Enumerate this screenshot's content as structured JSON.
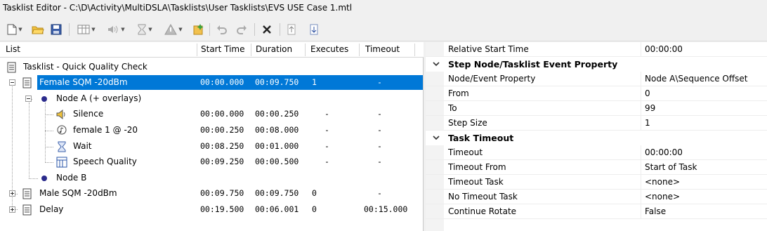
{
  "window": {
    "title": "Tasklist Editor - C:\\D\\Activity\\MultiDSLA\\Tasklists\\User Tasklists\\EVS USE Case 1.mtl"
  },
  "toolbar": {
    "buttons": [
      "new-icon",
      "open-folder-icon",
      "save-icon",
      "table-icon",
      "volume-icon",
      "hourglass-icon",
      "warning-icon",
      "add-task-icon",
      "undo-icon",
      "redo-icon",
      "delete-icon",
      "move-up-icon",
      "move-down-icon"
    ]
  },
  "list": {
    "headers": {
      "list": "List",
      "start": "Start Time",
      "duration": "Duration",
      "executes": "Executes",
      "timeout": "Timeout"
    },
    "rows": [
      {
        "label": "Tasklist - Quick Quality Check",
        "start": "",
        "duration": "",
        "executes": "",
        "timeout": ""
      },
      {
        "label": "Female SQM -20dBm",
        "start": "00:00.000",
        "duration": "00:09.750",
        "executes": "1",
        "timeout": "-"
      },
      {
        "label": "Node A (+ overlays)",
        "start": "",
        "duration": "",
        "executes": "",
        "timeout": ""
      },
      {
        "label": "Silence",
        "start": "00:00.000",
        "duration": "00:00.250",
        "executes": "-",
        "timeout": "-"
      },
      {
        "label": "female 1 @ -20",
        "start": "00:00.250",
        "duration": "00:08.000",
        "executes": "-",
        "timeout": "-"
      },
      {
        "label": "Wait",
        "start": "00:08.250",
        "duration": "00:01.000",
        "executes": "-",
        "timeout": "-"
      },
      {
        "label": "Speech Quality",
        "start": "00:09.250",
        "duration": "00:00.500",
        "executes": "-",
        "timeout": "-"
      },
      {
        "label": "Node B",
        "start": "",
        "duration": "",
        "executes": "",
        "timeout": ""
      },
      {
        "label": "Male SQM -20dBm",
        "start": "00:09.750",
        "duration": "00:09.750",
        "executes": "0",
        "timeout": "-"
      },
      {
        "label": "Delay",
        "start": "00:19.500",
        "duration": "00:06.001",
        "executes": "0",
        "timeout": "00:15.000"
      }
    ]
  },
  "properties": {
    "top": {
      "name": "Relative Start Time",
      "value": "00:00:00"
    },
    "cat1": {
      "title": "Step Node/Tasklist Event Property",
      "items": [
        {
          "name": "Node/Event Property",
          "value": "Node A\\Sequence Offset"
        },
        {
          "name": "From",
          "value": "0"
        },
        {
          "name": "To",
          "value": "99"
        },
        {
          "name": "Step Size",
          "value": "1"
        }
      ]
    },
    "cat2": {
      "title": "Task Timeout",
      "items": [
        {
          "name": "Timeout",
          "value": "00:00:00"
        },
        {
          "name": "Timeout From",
          "value": "Start of Task"
        },
        {
          "name": "Timeout Task",
          "value": "<none>"
        },
        {
          "name": "No Timeout Task",
          "value": "<none>"
        },
        {
          "name": "Continue Rotate",
          "value": "False"
        }
      ]
    }
  }
}
